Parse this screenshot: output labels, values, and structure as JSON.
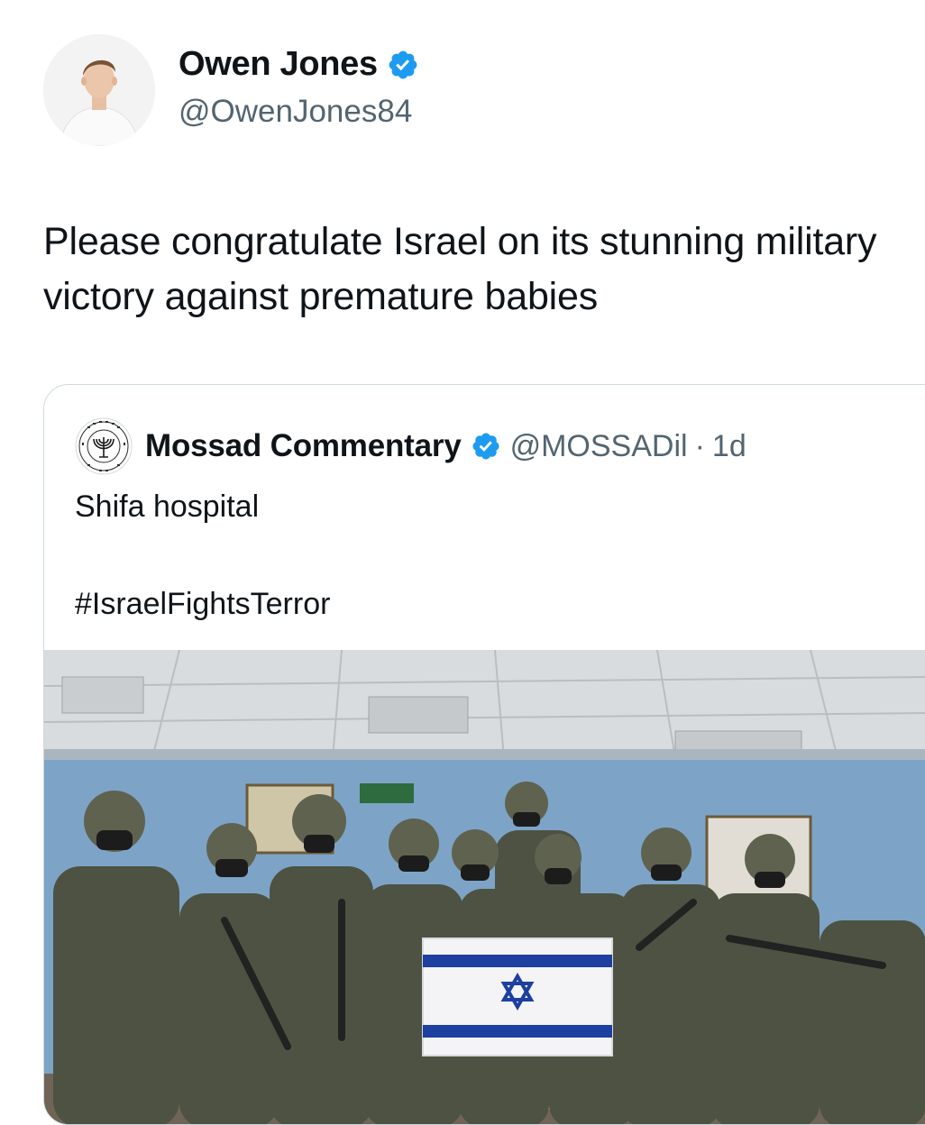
{
  "tweet": {
    "author": {
      "display_name": "Owen Jones",
      "handle": "@OwenJones84",
      "verified": true,
      "avatar_icon": "profile-photo"
    },
    "text": "Please congratulate Israel on its stunning military victory against premature babies"
  },
  "quoted_tweet": {
    "author": {
      "display_name": "Mossad Commentary",
      "handle": "@MOSSADil",
      "verified": true,
      "avatar_icon": "mossad-emblem"
    },
    "separator": "·",
    "time": "1d",
    "text_line_1": "Shifa hospital",
    "text_line_2": "#IsraelFightsTerror",
    "media": {
      "type": "photo",
      "description_icon": "soldiers-with-flag-photo"
    }
  },
  "colors": {
    "verified_blue": "#1d9bf0",
    "text_primary": "#0f1419",
    "text_secondary": "#536471",
    "border": "#cfd9de"
  }
}
